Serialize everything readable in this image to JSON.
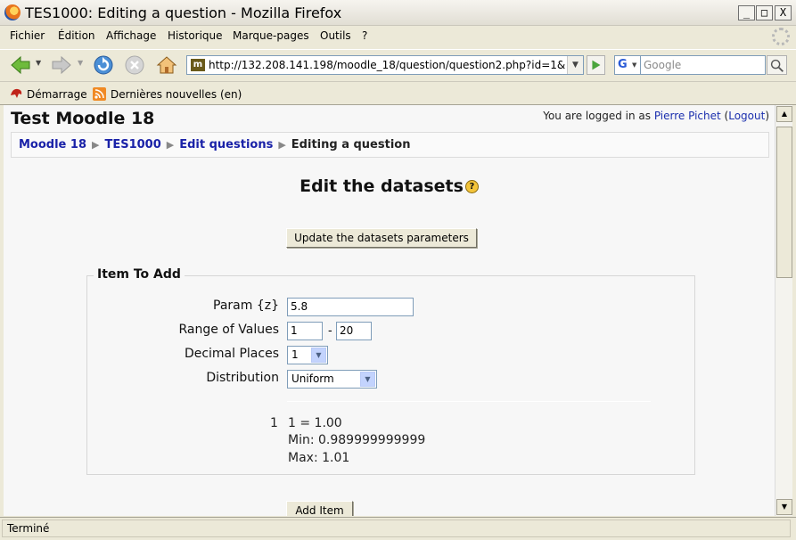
{
  "window": {
    "title": "TES1000: Editing a question - Mozilla Firefox",
    "controls": [
      "_",
      "□",
      "X"
    ]
  },
  "menu": [
    "Fichier",
    "Édition",
    "Affichage",
    "Historique",
    "Marque-pages",
    "Outils",
    "?"
  ],
  "nav": {
    "url": "http://132.208.141.198/moodle_18/question/question2.php?id=1&retur",
    "search_placeholder": "Google",
    "search_engine_letter": "G",
    "icons": [
      "back-arrow-icon",
      "forward-arrow-icon",
      "reload-icon",
      "stop-icon",
      "home-icon",
      "go-icon",
      "search-icon"
    ]
  },
  "bookmarks": [
    "Démarrage",
    "Dernières nouvelles (en)"
  ],
  "page": {
    "site_title": "Test Moodle 18",
    "login_prefix": "You are logged in as ",
    "user_name": "Pierre Pichet",
    "logout_label": "Logout",
    "breadcrumb": [
      "Moodle 18",
      "TES1000",
      "Edit questions",
      "Editing a question"
    ],
    "heading": "Edit the datasets",
    "update_button": "Update the datasets parameters",
    "fieldset_legend": "Item To Add",
    "param_label": "Param {z}",
    "param_value": "5.8",
    "range_label": "Range of Values",
    "range_min": "1",
    "range_separator": "-",
    "range_max": "20",
    "decimal_label": "Decimal Places",
    "decimal_value": "1",
    "distribution_label": "Distribution",
    "distribution_value": "Uniform",
    "item_number": "1",
    "result_line": "1 = 1.00",
    "min_line": "Min: 0.989999999999",
    "max_line": "Max: 1.01",
    "add_button": "Add Item"
  },
  "status": "Terminé"
}
